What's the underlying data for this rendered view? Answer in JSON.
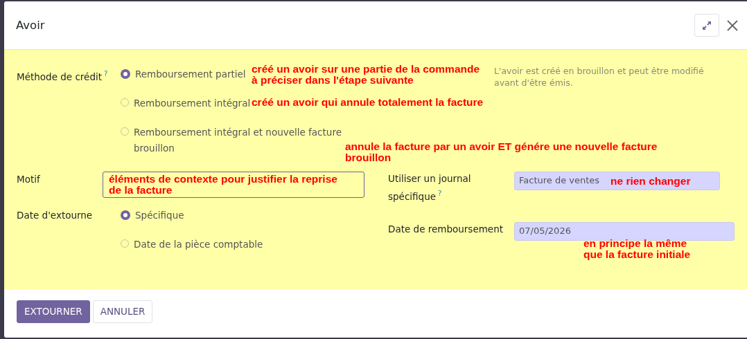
{
  "dialog": {
    "title": "Avoir"
  },
  "credit_method": {
    "label": "Méthode de crédit$^{?}$",
    "help_text": "L'avoir est créé en brouillon et peut être modifié avant d'être émis.",
    "options": [
      {
        "label": "Remboursement partiel",
        "selected": true
      },
      {
        "label": "Remboursement intégral",
        "selected": false
      },
      {
        "label": "Remboursement intégral et nouvelle facture brouillon",
        "selected": false
      }
    ]
  },
  "motif": {
    "label": "Motif"
  },
  "reversal_date": {
    "label": "Date d'extourne",
    "options": [
      {
        "label": "Spécifique",
        "selected": true
      },
      {
        "label": "Date de la pièce comptable",
        "selected": false
      }
    ]
  },
  "journal": {
    "label": "Utiliser un journal spécifique$^{?}$",
    "value": "Facture de ventes"
  },
  "refund_date": {
    "label": "Date de remboursement",
    "value": "07/05/2026"
  },
  "buttons": [
    {
      "label": "EXTOURNER",
      "kind": "primary"
    },
    {
      "label": "ANNULER",
      "kind": "secondary"
    }
  ],
  "annotations": [
    {
      "lines": [
        "créé un avoir sur une partie de la commande",
        "à préciser dans l'étape suivante"
      ]
    },
    {
      "lines": [
        "créé un avoir qui annule totalement la facture"
      ]
    },
    {
      "lines": [
        "annule la facture par un avoir ET génére une nouvelle facture",
        "brouillon"
      ]
    },
    {
      "lines": [
        "éléments de contexte pour justifier la reprise",
        "de la facture"
      ]
    },
    {
      "lines": [
        "ne rien changer"
      ]
    },
    {
      "lines": [
        "en principe la même",
        "que la facture initiale"
      ]
    }
  ]
}
